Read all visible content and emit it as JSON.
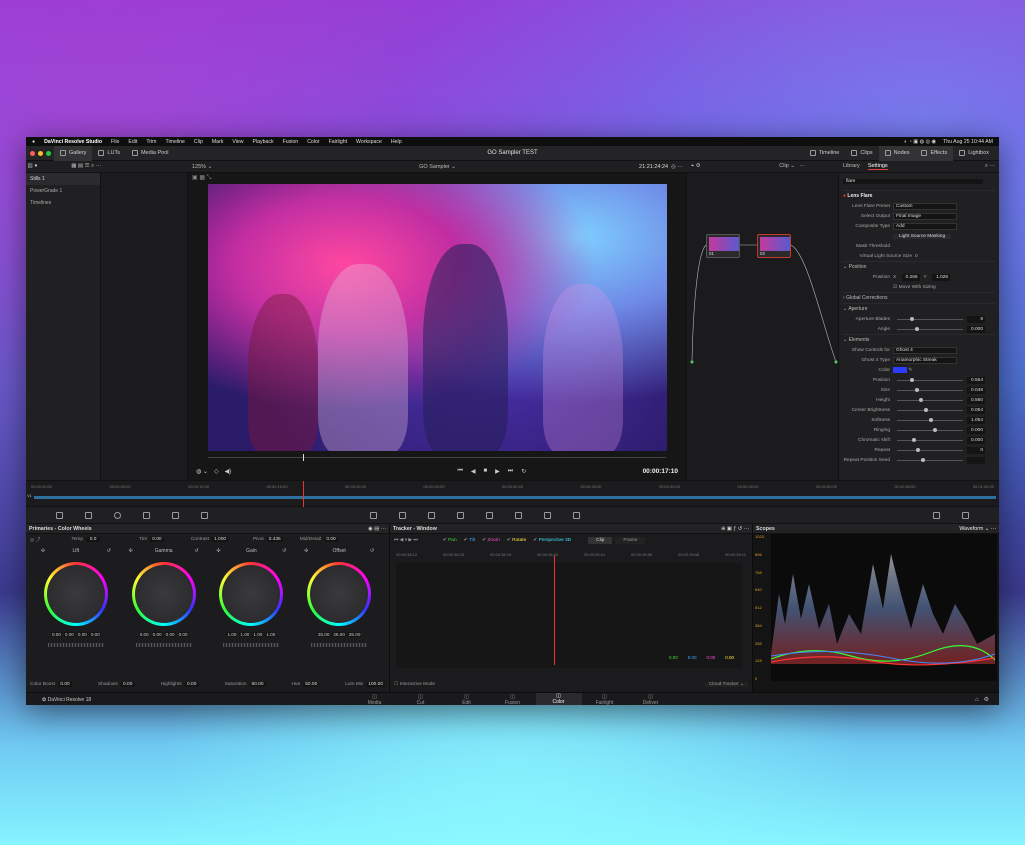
{
  "menubar": {
    "app": "DaVinci Resolve Studio",
    "items": [
      "File",
      "Edit",
      "Trim",
      "Timeline",
      "Clip",
      "Mark",
      "View",
      "Playback",
      "Fusion",
      "Color",
      "Fairlight",
      "Workspace",
      "Help"
    ],
    "clock": "Thu Aug 25  10:44 AM"
  },
  "toolbar": {
    "left": [
      "Gallery",
      "LUTs",
      "Media Pool"
    ],
    "project": "GO Sampler TEST",
    "right": [
      "Timeline",
      "Clips",
      "Nodes",
      "Effects",
      "Lightbox"
    ]
  },
  "viewer": {
    "zoom": "125%",
    "clip_name": "GO Sampler",
    "timecode": "21:21:24:24",
    "mode": "Clip",
    "current_time": "00:00:17:10"
  },
  "gallery": {
    "items": [
      "Stills 1",
      "PowerGrade 1",
      "Timelines"
    ]
  },
  "effects": {
    "tabs": [
      "Library",
      "Settings"
    ],
    "search": "flare",
    "title": "Lens Flare",
    "rows": [
      {
        "label": "Lens Flare Preset",
        "value": "Custom"
      },
      {
        "label": "Select Output",
        "value": "Final Image"
      },
      {
        "label": "Composite Type",
        "value": "Add"
      }
    ],
    "light_source": "Light Source Masking",
    "mask_threshold": "Mask Threshold",
    "virtual_size": {
      "label": "Virtual Light Source Size",
      "value": "0"
    },
    "position_section": "Position",
    "position": {
      "label": "Position",
      "x_label": "X",
      "x": "0.266",
      "y_label": "Y",
      "y": "1.026"
    },
    "move_with_sizing": "Move With Sizing",
    "sections": [
      "Global Corrections",
      "Aperture"
    ],
    "aperture": [
      {
        "label": "Aperture Blades",
        "value": "8"
      },
      {
        "label": "Angle",
        "value": "0.000"
      }
    ],
    "elements_section": "Elements",
    "show_controls": {
      "label": "Show Controls for",
      "value": "Ghost 4"
    },
    "ghost_type": {
      "label": "Ghost 4 Type",
      "value": "Anamorphic Streak"
    },
    "color_label": "Color",
    "color": "#2b3bff",
    "elements": [
      {
        "label": "Position",
        "value": "0.554"
      },
      {
        "label": "Size",
        "value": "0.048"
      },
      {
        "label": "Height",
        "value": "0.560"
      },
      {
        "label": "Center Brightness",
        "value": "0.054"
      },
      {
        "label": "Softness",
        "value": "1.054"
      },
      {
        "label": "Ringing",
        "value": "0.000"
      },
      {
        "label": "Chromatic shift",
        "value": "0.000"
      },
      {
        "label": "Repeat",
        "value": "0"
      },
      {
        "label": "Repeat Position Seed",
        "value": ""
      }
    ]
  },
  "nodes": {
    "items": [
      {
        "label": "01"
      },
      {
        "label": "02"
      }
    ]
  },
  "timeline": {
    "ticks": [
      "00:00:00:00",
      "00:00:05:00",
      "00:00:10:00",
      "00:00:15:00",
      "00:00:20:00",
      "00:00:25:00",
      "00:00:30:00",
      "00:00:35:00",
      "00:00:40:00",
      "00:00:45:00",
      "00:00:50:00",
      "00:00:55:00",
      "00:01:00:00"
    ],
    "track": "V1"
  },
  "primaries": {
    "title": "Primaries - Color Wheels",
    "temp_label": "Temp",
    "temp": "0.0",
    "tint_label": "Tint",
    "tint": "0.00",
    "contrast_label": "Contrast",
    "contrast": "1.000",
    "pivot_label": "Pivot",
    "pivot": "0.435",
    "mid_label": "Mid/Detail",
    "mid": "0.00",
    "wheels": [
      {
        "name": "Lift",
        "values": [
          "0.00",
          "0.00",
          "0.00",
          "0.00"
        ]
      },
      {
        "name": "Gamma",
        "values": [
          "0.00",
          "0.00",
          "0.00",
          "0.00"
        ]
      },
      {
        "name": "Gain",
        "values": [
          "1.00",
          "1.00",
          "1.00",
          "1.00"
        ]
      },
      {
        "name": "Offset",
        "values": [
          "25.00",
          "25.00",
          "25.00"
        ]
      }
    ],
    "bottom": [
      {
        "label": "Color Boost",
        "value": "0.00"
      },
      {
        "label": "Shadows",
        "value": "0.00"
      },
      {
        "label": "Highlights",
        "value": "0.00"
      },
      {
        "label": "Saturation",
        "value": "50.00"
      },
      {
        "label": "Hue",
        "value": "50.00"
      },
      {
        "label": "Lum Mix",
        "value": "100.00"
      }
    ]
  },
  "tracker": {
    "title": "Tracker - Window",
    "checks": [
      "Pan",
      "Tilt",
      "Zoom",
      "Rotate",
      "Perspective 3D"
    ],
    "check_colors": [
      "#3fdc3f",
      "#3fa0ff",
      "#ff4fd8",
      "#ffe23f",
      "#3fe8ff"
    ],
    "modes": [
      "Clip",
      "Frame"
    ],
    "ticks": [
      "00:00:38:12",
      "00:00:38:15",
      "00:00:38:19",
      "00:00:38:22",
      "00:00:39:01",
      "00:00:39:05",
      "00:00:39:08",
      "00:00:39:11"
    ],
    "readout": [
      "0.00",
      "8.00",
      "0.00",
      "0.00"
    ],
    "interactive": "Interactive Mode",
    "cloud": "Cloud Tracker"
  },
  "scopes": {
    "title": "Scopes",
    "mode": "Waveform",
    "scale": [
      "1023",
      "896",
      "768",
      "640",
      "512",
      "384",
      "256",
      "128",
      "0"
    ]
  },
  "pages": {
    "app_name": "DaVinci Resolve 18",
    "items": [
      "Media",
      "Cut",
      "Edit",
      "Fusion",
      "Color",
      "Fairlight",
      "Deliver"
    ],
    "active": "Color"
  }
}
